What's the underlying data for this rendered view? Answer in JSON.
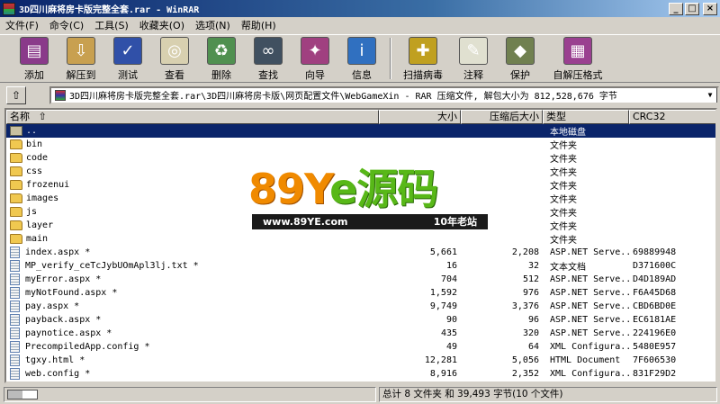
{
  "window": {
    "title": "3D四川麻将房卡版完整全套.rar - WinRAR",
    "min": "_",
    "max": "□",
    "close": "×"
  },
  "menu": [
    "文件(F)",
    "命令(C)",
    "工具(S)",
    "收藏夹(O)",
    "选项(N)",
    "帮助(H)"
  ],
  "toolbar": [
    {
      "label": "添加",
      "icon": "add-books-icon",
      "color": "#8a3a8a",
      "glyph": "▤"
    },
    {
      "label": "解压到",
      "icon": "extract-folder-icon",
      "color": "#c8a050",
      "glyph": "⇩"
    },
    {
      "label": "测试",
      "icon": "test-check-icon",
      "color": "#3050a8",
      "glyph": "✓"
    },
    {
      "label": "查看",
      "icon": "view-glasses-icon",
      "color": "#d8d0b0",
      "glyph": "◎"
    },
    {
      "label": "删除",
      "icon": "delete-recycle-icon",
      "color": "#509050",
      "glyph": "♻"
    },
    {
      "label": "查找",
      "icon": "find-binoculars-icon",
      "color": "#405060",
      "glyph": "∞"
    },
    {
      "label": "向导",
      "icon": "wizard-icon",
      "color": "#a04080",
      "glyph": "✦"
    },
    {
      "label": "信息",
      "icon": "info-icon",
      "color": "#3070c0",
      "glyph": "i"
    },
    {
      "label": "扫描病毒",
      "icon": "virus-scan-icon",
      "color": "#c0a020",
      "glyph": "✚"
    },
    {
      "label": "注释",
      "icon": "comment-icon",
      "color": "#e0e0d0",
      "glyph": "✎"
    },
    {
      "label": "保护",
      "icon": "protect-shield-icon",
      "color": "#708050",
      "glyph": "◆"
    },
    {
      "label": "自解压格式",
      "icon": "sfx-archive-icon",
      "color": "#9a4090",
      "glyph": "▦"
    }
  ],
  "address": {
    "path": "3D四川麻将房卡版完整全套.rar\\3D四川麻将房卡版\\网页配置文件\\WebGameXin - RAR 压缩文件, 解包大小为 812,528,676 字节",
    "up": "⇧",
    "drop": "▼"
  },
  "columns": {
    "name": "名称",
    "sort": "⇧",
    "size": "大小",
    "packed": "压缩后大小",
    "type": "类型",
    "crc": "CRC32"
  },
  "rows": [
    {
      "name": "..",
      "size": "",
      "packed": "",
      "type": "本地磁盘",
      "crc": "",
      "kind": "updir",
      "sel": true
    },
    {
      "name": "bin",
      "size": "",
      "packed": "",
      "type": "文件夹",
      "crc": "",
      "kind": "folder"
    },
    {
      "name": "code",
      "size": "",
      "packed": "",
      "type": "文件夹",
      "crc": "",
      "kind": "folder"
    },
    {
      "name": "css",
      "size": "",
      "packed": "",
      "type": "文件夹",
      "crc": "",
      "kind": "folder"
    },
    {
      "name": "frozenui",
      "size": "",
      "packed": "",
      "type": "文件夹",
      "crc": "",
      "kind": "folder"
    },
    {
      "name": "images",
      "size": "",
      "packed": "",
      "type": "文件夹",
      "crc": "",
      "kind": "folder"
    },
    {
      "name": "js",
      "size": "",
      "packed": "",
      "type": "文件夹",
      "crc": "",
      "kind": "folder"
    },
    {
      "name": "layer",
      "size": "",
      "packed": "",
      "type": "文件夹",
      "crc": "",
      "kind": "folder"
    },
    {
      "name": "main",
      "size": "",
      "packed": "",
      "type": "文件夹",
      "crc": "",
      "kind": "folder"
    },
    {
      "name": "index.aspx *",
      "size": "5,661",
      "packed": "2,208",
      "type": "ASP.NET Serve...",
      "crc": "69889948",
      "kind": "file"
    },
    {
      "name": "MP_verify_ceTcJybUOmApl3lj.txt *",
      "size": "16",
      "packed": "32",
      "type": "文本文档",
      "crc": "D371600C",
      "kind": "file"
    },
    {
      "name": "myError.aspx *",
      "size": "704",
      "packed": "512",
      "type": "ASP.NET Serve...",
      "crc": "D4D189AD",
      "kind": "file"
    },
    {
      "name": "myNotFound.aspx *",
      "size": "1,592",
      "packed": "976",
      "type": "ASP.NET Serve...",
      "crc": "F6A45D68",
      "kind": "file"
    },
    {
      "name": "pay.aspx *",
      "size": "9,749",
      "packed": "3,376",
      "type": "ASP.NET Serve...",
      "crc": "CBD6BD0E",
      "kind": "file"
    },
    {
      "name": "payback.aspx *",
      "size": "90",
      "packed": "96",
      "type": "ASP.NET Serve...",
      "crc": "EC6181AE",
      "kind": "file"
    },
    {
      "name": "paynotice.aspx *",
      "size": "435",
      "packed": "320",
      "type": "ASP.NET Serve...",
      "crc": "224196E0",
      "kind": "file"
    },
    {
      "name": "PrecompiledApp.config *",
      "size": "49",
      "packed": "64",
      "type": "XML Configura...",
      "crc": "5480E957",
      "kind": "file"
    },
    {
      "name": "tgxy.html *",
      "size": "12,281",
      "packed": "5,056",
      "type": "HTML Document",
      "crc": "7F606530",
      "kind": "file"
    },
    {
      "name": "web.config *",
      "size": "8,916",
      "packed": "2,352",
      "type": "XML Configura...",
      "crc": "831F29D2",
      "kind": "file"
    }
  ],
  "watermark": {
    "num": "89Y",
    "mid": "e",
    "cn": "源码",
    "url": "www.89YE.com",
    "slogan": "10年老站"
  },
  "status": {
    "summary": "总计 8 文件夹 和 39,493 字节(10 个文件)"
  }
}
